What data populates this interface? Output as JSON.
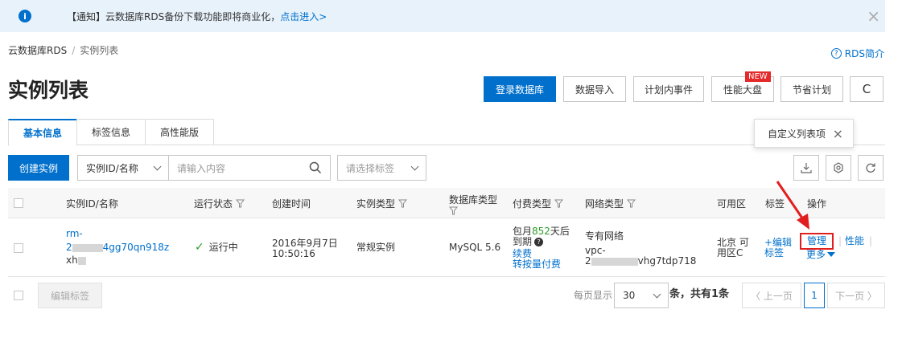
{
  "notice": {
    "text": "【通知】云数据库RDS备份下载功能即将商业化，",
    "link": "点击进入>",
    "close": "×"
  },
  "breadcrumb": {
    "root": "云数据库RDS",
    "sep": "/",
    "current": "实例列表"
  },
  "rds_intro": "RDS简介",
  "page_title": "实例列表",
  "top_buttons": {
    "login": "登录数据库",
    "import": "数据导入",
    "events": "计划内事件",
    "perf": "性能大盘",
    "new_badge": "NEW",
    "save": "节省计划",
    "refresh": "C"
  },
  "tabs": [
    "基本信息",
    "标签信息",
    "高性能版"
  ],
  "custom_columns": {
    "label": "自定义列表项",
    "close": "×"
  },
  "toolbar": {
    "create": "创建实例",
    "search_type": "实例ID/名称",
    "search_placeholder": "请输入内容",
    "tag_placeholder": "请选择标签"
  },
  "columns": {
    "id": "实例ID/名称",
    "status": "运行状态",
    "created": "创建时间",
    "type": "实例类型",
    "dbtype": "数据库类型",
    "billing": "付费类型",
    "network": "网络类型",
    "zone": "可用区",
    "tags": "标签",
    "actions": "操作"
  },
  "row": {
    "id_line1": "rm-",
    "id_line2a": "2",
    "id_line2b": "4gg70qn918z",
    "id_line3": "xh",
    "status": "运行中",
    "created_date": "2016年9月7日",
    "created_time": "10:50:16",
    "type": "常规实例",
    "dbtype": "MySQL 5.6",
    "billing_pre": "包月",
    "billing_days": "852",
    "billing_post": "天后",
    "billing_expire": "到期",
    "renew": "续费",
    "to_payg": "转按量付费",
    "network": "专有网络",
    "vpc": "vpc-",
    "vpc_a": "2",
    "vpc_b": "vhg7tdp718",
    "zone_line1": "北京 可",
    "zone_line2": "用区C",
    "tag_edit_1": "+编辑",
    "tag_edit_2": "标签",
    "manage": "管理",
    "perf": "性能",
    "more": "更多"
  },
  "footer": {
    "edit_tags": "编辑标签",
    "per_page_label": "每页显示",
    "per_page": "30",
    "total": "条，共有1条",
    "prev": "〈 上一页",
    "page": "1",
    "next": "下一页 〉"
  }
}
